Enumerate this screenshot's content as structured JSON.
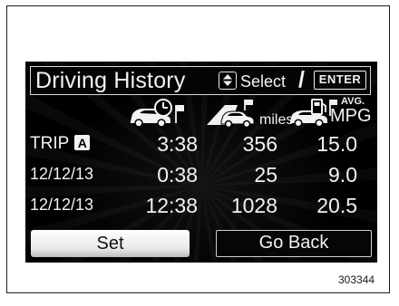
{
  "header": {
    "title": "Driving History",
    "updown_icon": "up-down-arrows-icon",
    "select_label": "Select",
    "slash": "/",
    "enter_label": "ENTER"
  },
  "columns": {
    "time_icon": "car-clock-flag-icon",
    "distance_icon": "car-road-flag-icon",
    "distance_unit": "miles",
    "economy_icon": "car-fuel-pump-icon",
    "economy_avg": "AVG.",
    "economy_unit": "MPG"
  },
  "rows": [
    {
      "label": "TRIP",
      "badge": "A",
      "time": "3:38",
      "distance": "356",
      "economy": "15.0"
    },
    {
      "label": "12/12/13",
      "badge": "",
      "time": "0:38",
      "distance": "25",
      "economy": "9.0"
    },
    {
      "label": "12/12/13",
      "badge": "",
      "time": "12:38",
      "distance": "1028",
      "economy": "20.5"
    }
  ],
  "buttons": {
    "set": "Set",
    "go_back": "Go Back"
  },
  "figure_code": "303344",
  "colors": {
    "screen_bg": "#000000",
    "text": "#f2f2f2",
    "selected_button": "#ffffff"
  }
}
